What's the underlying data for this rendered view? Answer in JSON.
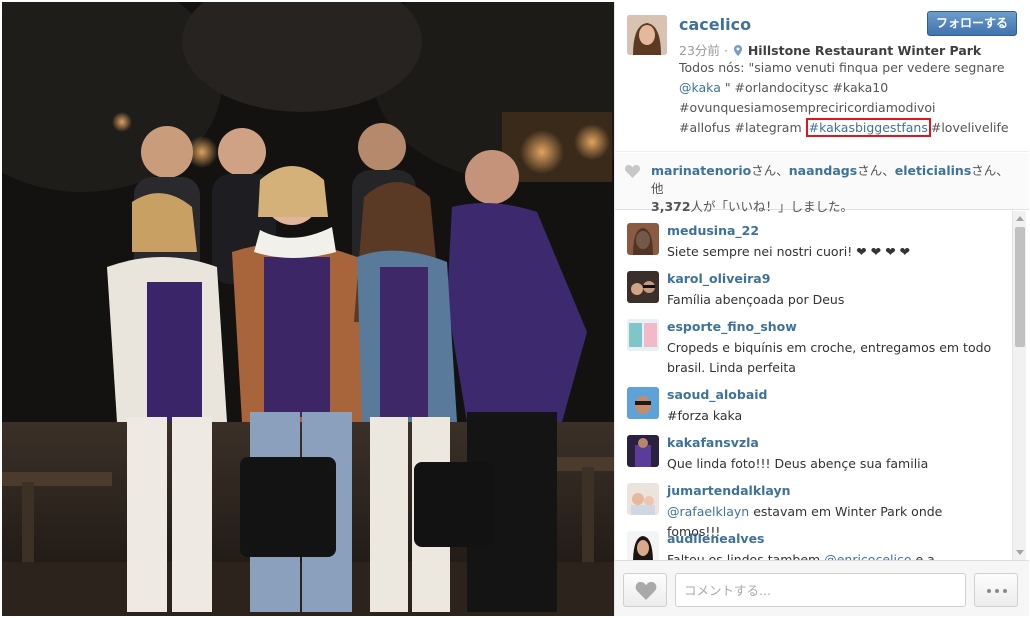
{
  "post": {
    "username": "cacelico",
    "follow_label": "フォローする",
    "time_ago": "23分前",
    "separator": "·",
    "location": "Hillstone Restaurant Winter Park",
    "caption": {
      "line1": "Todos nós: \"siamo venuti finqua per vedere segnare",
      "line2_tag": "@kaka",
      "line2_rest": " \" #orlandocitysc #kaka10 ",
      "line3": "#ovunquesiamosempreciricordiamodivoi ",
      "line4_pre": "#allofus #lategram ",
      "line4_hl": "#kakasbiggestfans",
      "line4_post": "#lovelivelife"
    }
  },
  "likes": {
    "user1": "marinatenorio",
    "user2": "naandags",
    "user3": "eleticialins",
    "san": "さん、",
    "san_other": "さん、他",
    "count": "3,372",
    "suffix": "人が「いいね！」しました。"
  },
  "comments": [
    {
      "user": "medusina_22",
      "text": "Siete sempre nei nostri cuori! ❤ ❤ ❤ ❤ "
    },
    {
      "user": "karol_oliveira9",
      "text": "Família abençoada por Deus "
    },
    {
      "user": "esporte_fino_show",
      "text": "Cropeds e biquínis em croche, entregamos em todo brasil. Linda perfeita"
    },
    {
      "user": "saoud_alobaid",
      "text": "#forza  kaka"
    },
    {
      "user": "kakafansvzla",
      "text": "Que linda foto!!! Deus abençe sua familia"
    },
    {
      "user": "jumartendalklayn",
      "tag": "@rafaelklayn",
      "text": " estavam em Winter Park onde fomos!!!"
    },
    {
      "user": "audilenealves",
      "text": "Faltou os lindos tambem ",
      "tag": "@enricocelico",
      "text2": " e a"
    }
  ],
  "footer": {
    "comment_placeholder": "コメントする..."
  },
  "colors": {
    "link": "#3f729b",
    "follow_button": "#4a7fbd",
    "highlight_box": "#e0151f"
  }
}
